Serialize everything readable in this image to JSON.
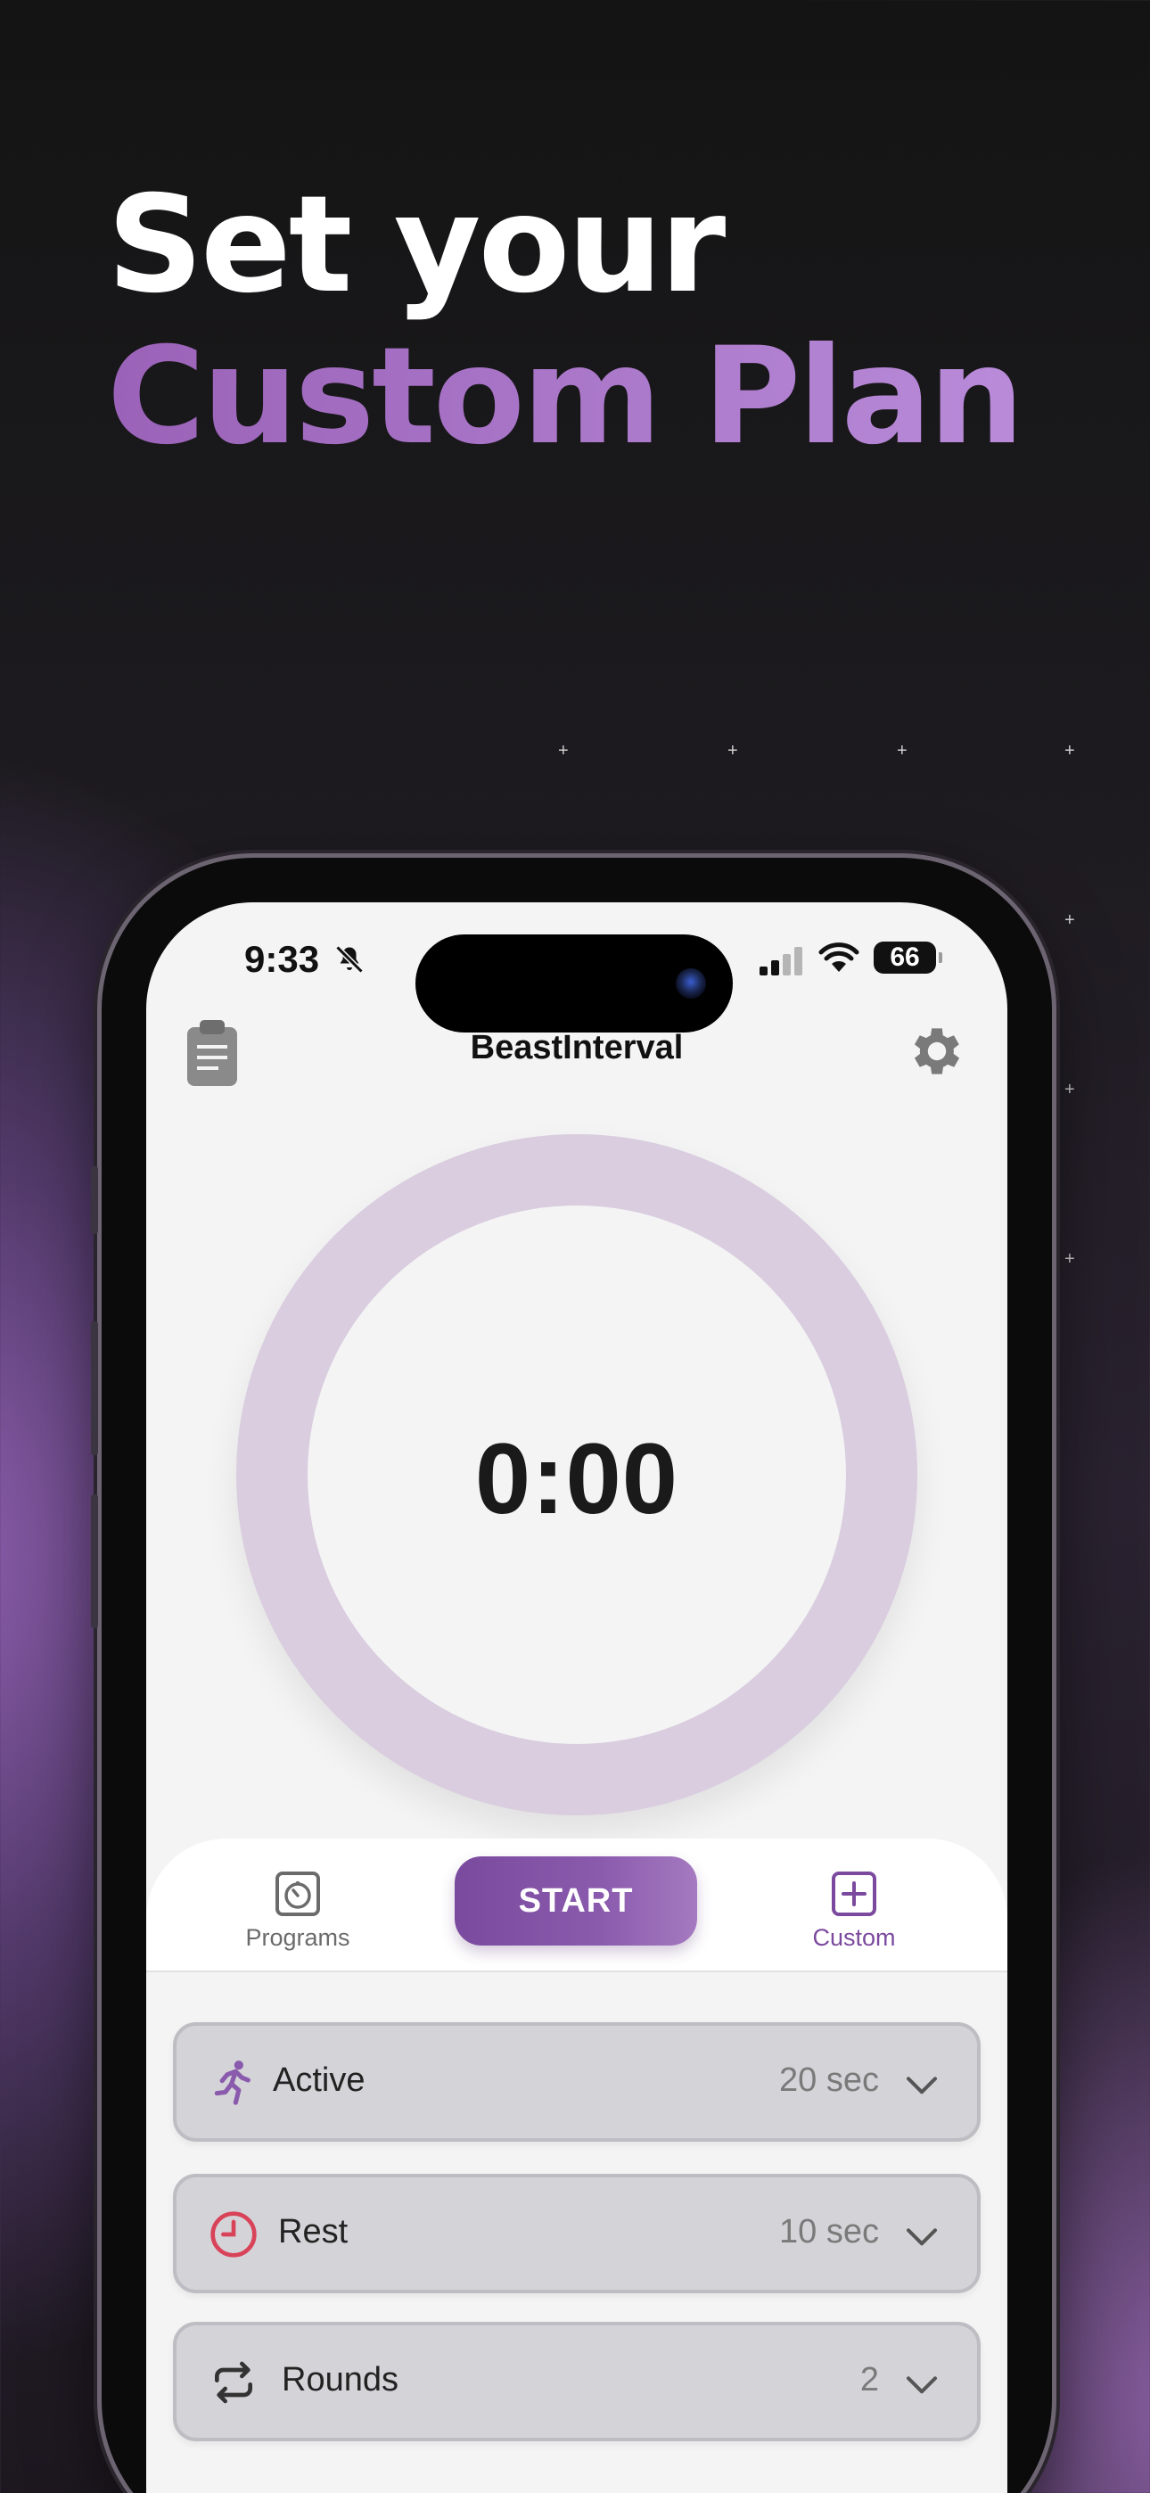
{
  "headline": {
    "line1": "Set your",
    "line2": "Custom Plan"
  },
  "status_bar": {
    "time": "9:33",
    "battery": "66"
  },
  "app": {
    "title": "BeastInterval"
  },
  "timer": {
    "display": "0:00"
  },
  "tabs": {
    "programs": "Programs",
    "start": "START",
    "custom": "Custom"
  },
  "settings": [
    {
      "label": "Active",
      "value": "20 sec",
      "icon": "running-icon"
    },
    {
      "label": "Rest",
      "value": "10 sec",
      "icon": "clock-icon"
    },
    {
      "label": "Rounds",
      "value": "2",
      "icon": "repeat-icon"
    }
  ],
  "colors": {
    "accent_purple": "#7b4a9e",
    "ring": "#d9cddf",
    "rest_red": "#d9435a"
  }
}
